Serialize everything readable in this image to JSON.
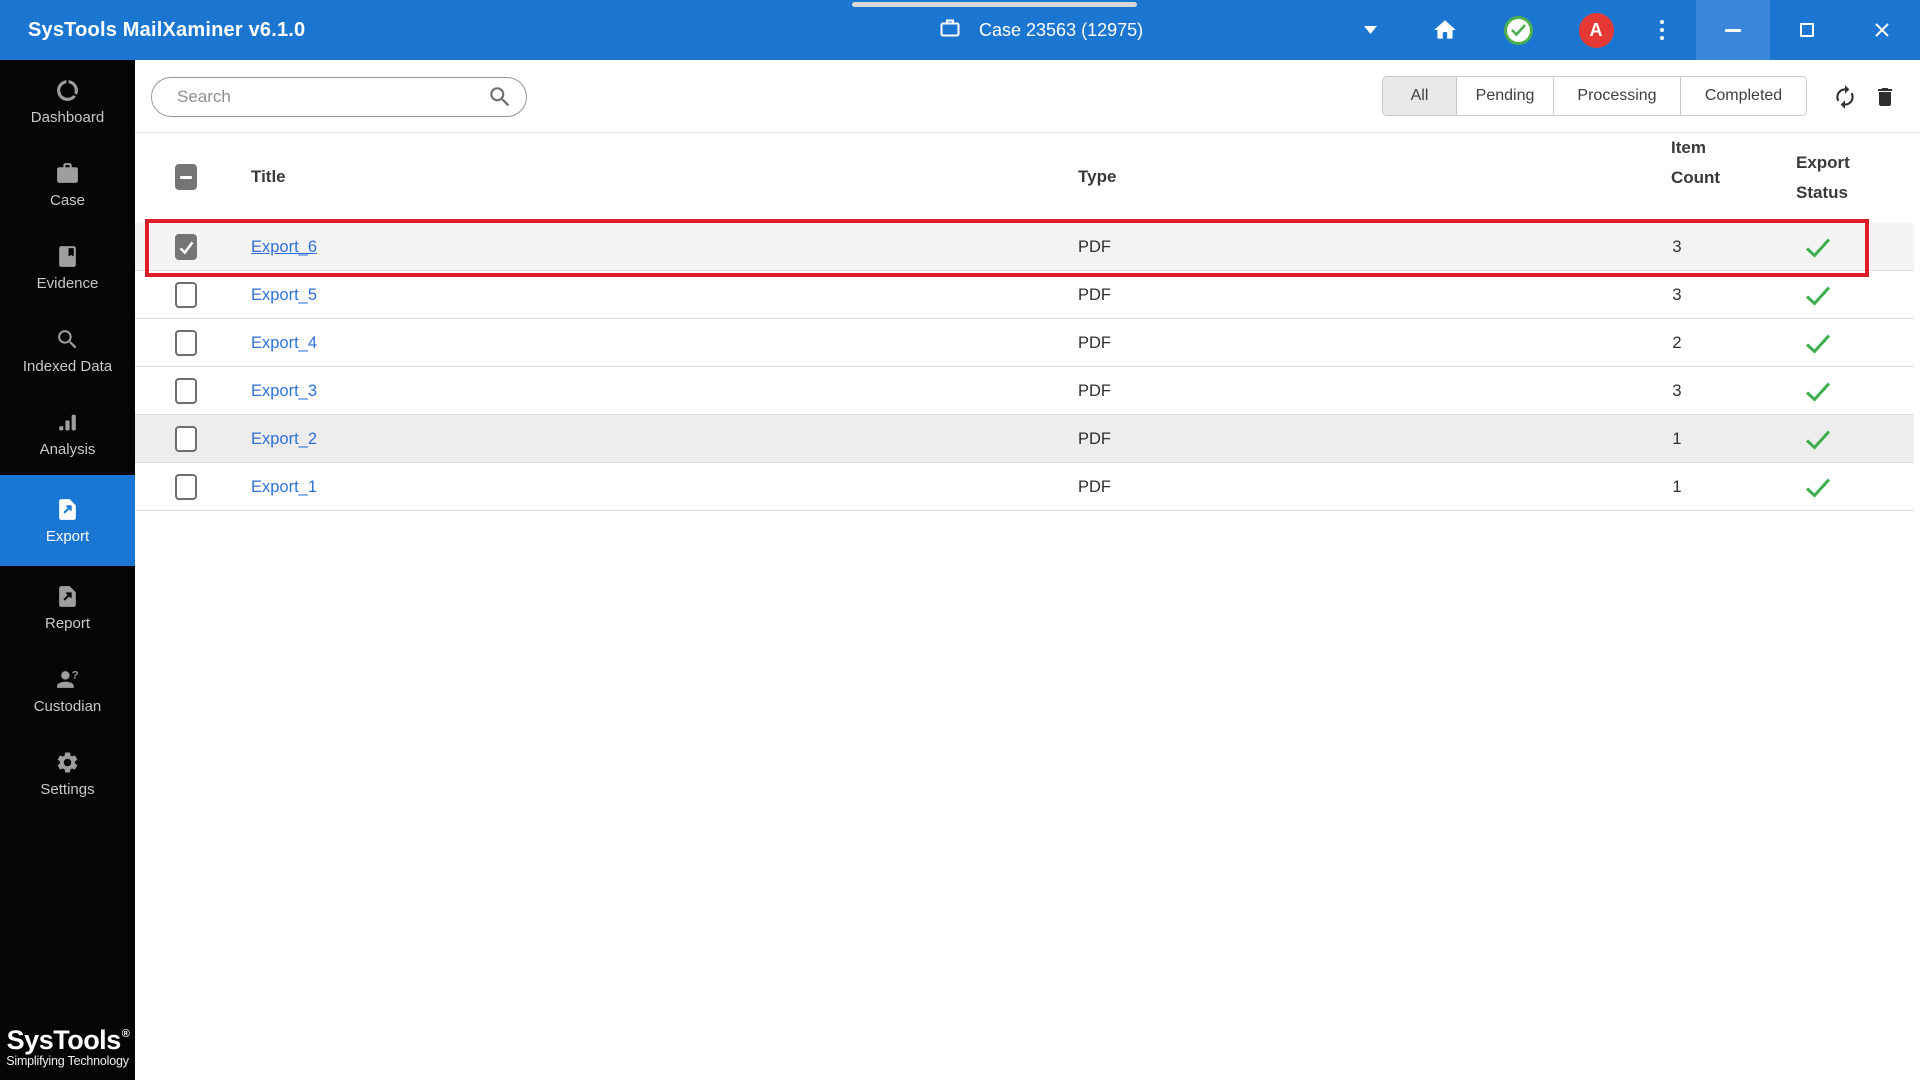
{
  "titlebar": {
    "app_title": "SysTools MailXaminer v6.1.0",
    "case_label": "Case 23563 (12975)",
    "avatar_initial": "A"
  },
  "sidebar": {
    "items": [
      {
        "label": "Dashboard",
        "icon": "dashboard-icon",
        "active": false
      },
      {
        "label": "Case",
        "icon": "case-icon",
        "active": false
      },
      {
        "label": "Evidence",
        "icon": "evidence-icon",
        "active": false
      },
      {
        "label": "Indexed Data",
        "icon": "indexed-data-icon",
        "active": false
      },
      {
        "label": "Analysis",
        "icon": "analysis-icon",
        "active": false
      },
      {
        "label": "Export",
        "icon": "export-icon",
        "active": true
      },
      {
        "label": "Report",
        "icon": "report-icon",
        "active": false
      },
      {
        "label": "Custodian",
        "icon": "custodian-icon",
        "active": false
      },
      {
        "label": "Settings",
        "icon": "settings-icon",
        "active": false
      }
    ],
    "logo": {
      "brand": "SysTools",
      "registered": "®",
      "tagline": "Simplifying Technology"
    }
  },
  "toolbar": {
    "search_placeholder": "Search",
    "filters": [
      {
        "label": "All",
        "active": true
      },
      {
        "label": "Pending",
        "active": false
      },
      {
        "label": "Processing",
        "active": false
      },
      {
        "label": "Completed",
        "active": false
      }
    ]
  },
  "table": {
    "headers": {
      "title": "Title",
      "type": "Type",
      "item_count_line1": "Item",
      "item_count_line2": "Count",
      "export_status_line1": "Export",
      "export_status_line2": "Status"
    },
    "rows": [
      {
        "title": "Export_6",
        "type": "PDF",
        "item_count": "3",
        "status": "completed",
        "checked": true,
        "highlighted": true,
        "shaded": "gray"
      },
      {
        "title": "Export_5",
        "type": "PDF",
        "item_count": "3",
        "status": "completed",
        "checked": false,
        "highlighted": false,
        "shaded": "none"
      },
      {
        "title": "Export_4",
        "type": "PDF",
        "item_count": "2",
        "status": "completed",
        "checked": false,
        "highlighted": false,
        "shaded": "none"
      },
      {
        "title": "Export_3",
        "type": "PDF",
        "item_count": "3",
        "status": "completed",
        "checked": false,
        "highlighted": false,
        "shaded": "none"
      },
      {
        "title": "Export_2",
        "type": "PDF",
        "item_count": "1",
        "status": "completed",
        "checked": false,
        "highlighted": false,
        "shaded": "gray-alt"
      },
      {
        "title": "Export_1",
        "type": "PDF",
        "item_count": "1",
        "status": "completed",
        "checked": false,
        "highlighted": false,
        "shaded": "none"
      }
    ]
  },
  "colors": {
    "topbar_blue": "#1b76d2",
    "active_blue": "#1976d2",
    "link_blue": "#2e70d9",
    "highlight_red": "#e01c24",
    "success_green": "#3fae4c",
    "avatar_red": "#e53935"
  }
}
